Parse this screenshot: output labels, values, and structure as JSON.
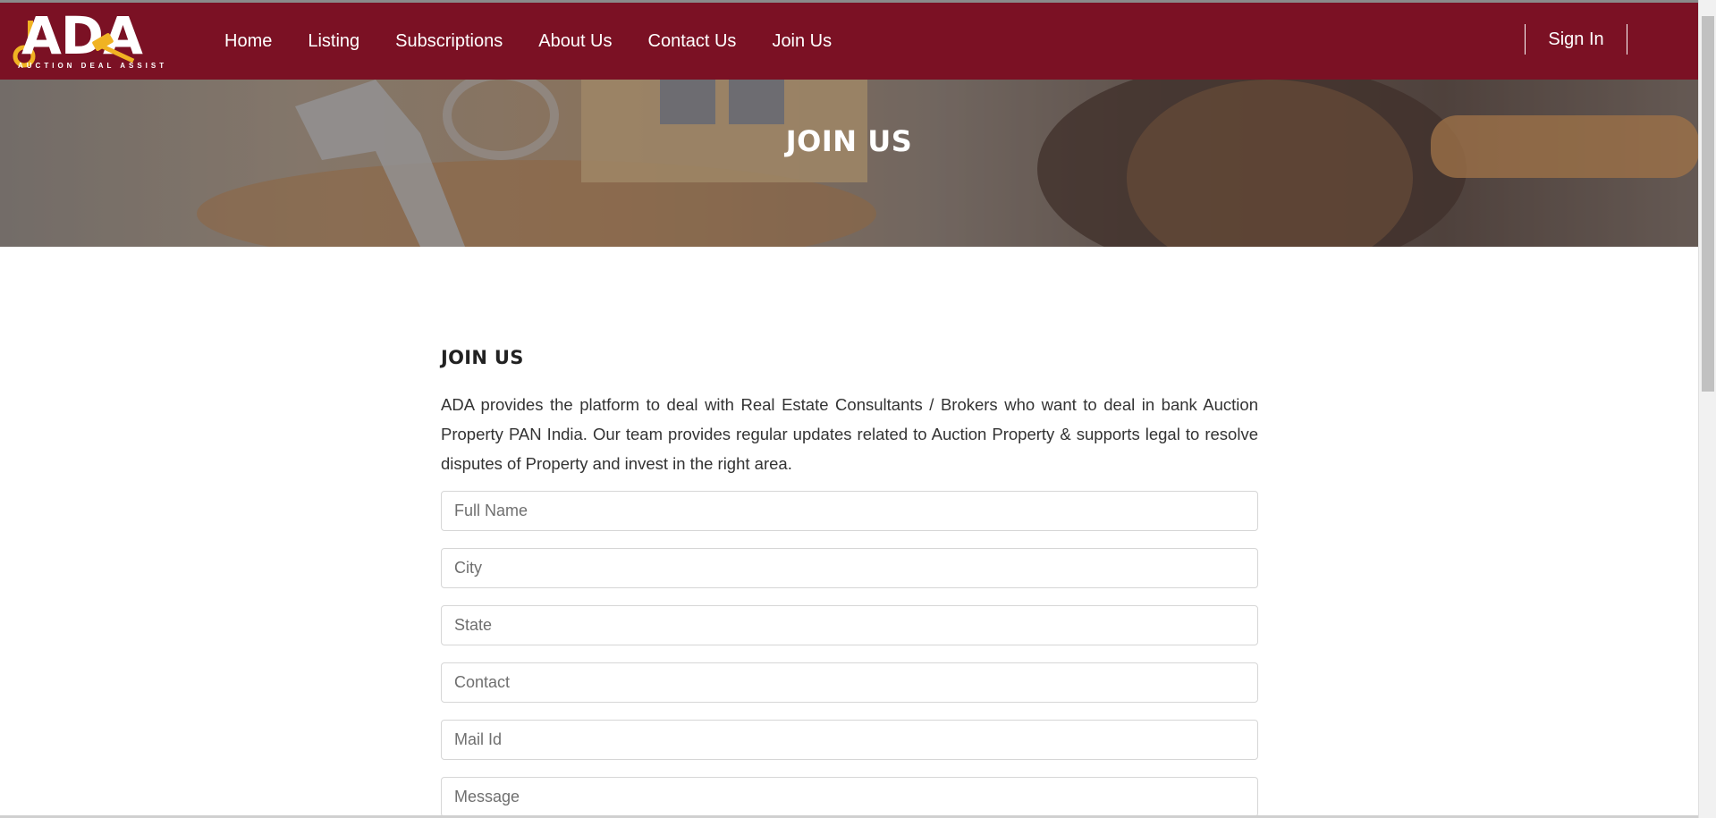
{
  "brand": {
    "logo_text": "ADA",
    "logo_subtitle": "AUCTION DEAL ASSIST",
    "colors": {
      "header": "#7b1124",
      "accent": "#f0b323"
    }
  },
  "nav": {
    "items": [
      {
        "label": "Home"
      },
      {
        "label": "Listing"
      },
      {
        "label": "Subscriptions"
      },
      {
        "label": "About Us"
      },
      {
        "label": "Contact Us"
      },
      {
        "label": "Join Us"
      }
    ],
    "sign_in": "Sign In"
  },
  "hero": {
    "title": "JOIN US"
  },
  "main": {
    "heading": "JOIN US",
    "intro": "ADA provides the platform to deal with Real Estate Consultants / Brokers who want to deal in bank Auction Property PAN India. Our team provides regular updates related to Auction Property & supports legal to resolve disputes of Property and invest in the right area."
  },
  "form": {
    "full_name_placeholder": "Full Name",
    "city_placeholder": "City",
    "state_placeholder": "State",
    "contact_placeholder": "Contact",
    "mail_placeholder": "Mail Id",
    "message_placeholder": "Message"
  }
}
